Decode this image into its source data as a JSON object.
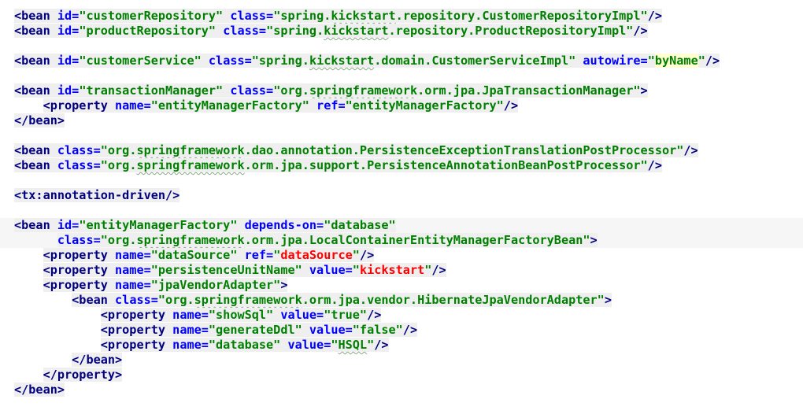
{
  "editor": {
    "lines": [
      [
        [
          "tag",
          "<bean "
        ],
        [
          "attr",
          "id="
        ],
        [
          "val",
          "\"customerRepository\" "
        ],
        [
          "attr",
          "class="
        ],
        [
          "val",
          "\"spring."
        ],
        [
          "val sq",
          "kickstart"
        ],
        [
          "val",
          ".repository.CustomerRepositoryImpl\""
        ],
        [
          "tag",
          "/>"
        ]
      ],
      [
        [
          "tag",
          "<bean "
        ],
        [
          "attr",
          "id="
        ],
        [
          "val",
          "\"productRepository\" "
        ],
        [
          "attr",
          "class="
        ],
        [
          "val",
          "\"spring."
        ],
        [
          "val sq",
          "kickstart"
        ],
        [
          "val",
          ".repository.ProductRepositoryImpl\""
        ],
        [
          "tag",
          "/>"
        ]
      ],
      [],
      [
        [
          "tag",
          "<bean "
        ],
        [
          "attr",
          "id="
        ],
        [
          "val",
          "\"customerService\" "
        ],
        [
          "attr",
          "class="
        ],
        [
          "val",
          "\"spring."
        ],
        [
          "val sq",
          "kickstart"
        ],
        [
          "val",
          ".domain.CustomerServiceImpl\" "
        ],
        [
          "attr",
          "autowire="
        ],
        [
          "val",
          "\""
        ],
        [
          "val hl",
          "byName"
        ],
        [
          "val",
          "\""
        ],
        [
          "tag",
          "/>"
        ]
      ],
      [],
      [
        [
          "tag",
          "<bean "
        ],
        [
          "attr",
          "id="
        ],
        [
          "val",
          "\"transactionManager\" "
        ],
        [
          "attr",
          "class="
        ],
        [
          "val",
          "\"org."
        ],
        [
          "val sq",
          "springframework"
        ],
        [
          "val",
          ".orm.jpa.JpaTransactionManager\""
        ],
        [
          "tag",
          ">"
        ]
      ],
      [
        [
          "",
          "    "
        ],
        [
          "tag",
          "<property "
        ],
        [
          "attr",
          "name="
        ],
        [
          "val",
          "\"entityManagerFactory\" "
        ],
        [
          "attr",
          "ref="
        ],
        [
          "val",
          "\"entityManagerFactory\""
        ],
        [
          "tag",
          "/>"
        ]
      ],
      [
        [
          "tag",
          "</bean>"
        ]
      ],
      [],
      [
        [
          "tag",
          "<bean "
        ],
        [
          "attr",
          "class="
        ],
        [
          "val",
          "\"org."
        ],
        [
          "val sq",
          "springframework"
        ],
        [
          "val",
          ".dao.annotation.PersistenceExceptionTranslationPostProcessor\""
        ],
        [
          "tag",
          "/>"
        ]
      ],
      [
        [
          "tag",
          "<bean "
        ],
        [
          "attr",
          "class="
        ],
        [
          "val",
          "\"org."
        ],
        [
          "val sq",
          "springframework"
        ],
        [
          "val",
          ".orm.jpa.support.PersistenceAnnotationBeanPostProcessor\""
        ],
        [
          "tag",
          "/>"
        ]
      ],
      [],
      [
        [
          "tag",
          "<tx:annotation-driven/>"
        ]
      ],
      [],
      [
        [
          "tag",
          "<bean "
        ],
        [
          "attr",
          "id="
        ],
        [
          "val",
          "\"entityManagerFactory\" "
        ],
        [
          "attr",
          "depends-on="
        ],
        [
          "val",
          "\"database\""
        ]
      ],
      [
        [
          "",
          "      "
        ],
        [
          "attr",
          "class="
        ],
        [
          "val",
          "\"org."
        ],
        [
          "val sq",
          "springframework"
        ],
        [
          "val",
          ".orm.jpa.LocalContainerEntityManagerFactoryBean\""
        ],
        [
          "tag",
          ">"
        ]
      ],
      [
        [
          "",
          "    "
        ],
        [
          "tag",
          "<property "
        ],
        [
          "attr",
          "name="
        ],
        [
          "val",
          "\"dataSource\" "
        ],
        [
          "attr",
          "ref="
        ],
        [
          "val",
          "\""
        ],
        [
          "val red",
          "dataSource"
        ],
        [
          "val",
          "\""
        ],
        [
          "tag",
          "/>"
        ]
      ],
      [
        [
          "",
          "    "
        ],
        [
          "tag",
          "<property "
        ],
        [
          "attr",
          "name="
        ],
        [
          "val",
          "\"persistenceUnitName\" "
        ],
        [
          "attr",
          "value="
        ],
        [
          "val",
          "\""
        ],
        [
          "val red",
          "kickstart"
        ],
        [
          "val",
          "\""
        ],
        [
          "tag",
          "/>"
        ]
      ],
      [
        [
          "",
          "    "
        ],
        [
          "tag",
          "<property "
        ],
        [
          "attr",
          "name="
        ],
        [
          "val",
          "\"jpaVendorAdapter\""
        ],
        [
          "tag",
          ">"
        ]
      ],
      [
        [
          "",
          "        "
        ],
        [
          "tag",
          "<bean "
        ],
        [
          "attr",
          "class="
        ],
        [
          "val",
          "\"org."
        ],
        [
          "val sq",
          "springframework"
        ],
        [
          "val",
          ".orm.jpa.vendor.HibernateJpaVendorAdapter\""
        ],
        [
          "tag",
          ">"
        ]
      ],
      [
        [
          "",
          "            "
        ],
        [
          "tag",
          "<property "
        ],
        [
          "attr",
          "name="
        ],
        [
          "val",
          "\"showSql\" "
        ],
        [
          "attr",
          "value="
        ],
        [
          "val",
          "\"true\""
        ],
        [
          "tag",
          "/>"
        ]
      ],
      [
        [
          "",
          "            "
        ],
        [
          "tag",
          "<property "
        ],
        [
          "attr",
          "name="
        ],
        [
          "val",
          "\"generateDdl\" "
        ],
        [
          "attr",
          "value="
        ],
        [
          "val",
          "\"false\""
        ],
        [
          "tag",
          "/>"
        ]
      ],
      [
        [
          "",
          "            "
        ],
        [
          "tag",
          "<property "
        ],
        [
          "attr",
          "name="
        ],
        [
          "val",
          "\"database\" "
        ],
        [
          "attr",
          "value="
        ],
        [
          "val",
          "\""
        ],
        [
          "val sq",
          "HSQL"
        ],
        [
          "val",
          "\""
        ],
        [
          "tag",
          "/>"
        ]
      ],
      [
        [
          "",
          "        "
        ],
        [
          "tag",
          "</bean>"
        ]
      ],
      [
        [
          "",
          "    "
        ],
        [
          "tag",
          "</property>"
        ]
      ],
      [
        [
          "tag",
          "</bean>"
        ]
      ]
    ]
  }
}
